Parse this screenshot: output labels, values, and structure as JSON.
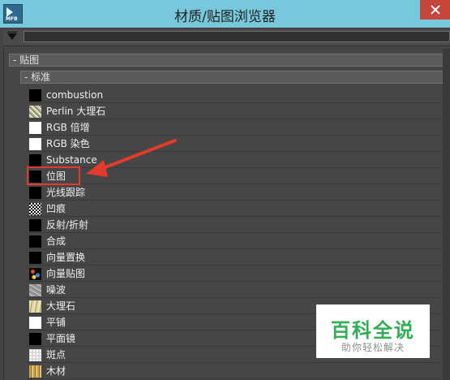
{
  "window": {
    "title": "材质/贴图浏览器"
  },
  "app_icon_text": "MFB",
  "search": {
    "value": "",
    "placeholder": ""
  },
  "groups": {
    "maps": "- 贴图",
    "standard": "- 标准"
  },
  "items": [
    {
      "label": "combustion",
      "icon": "black-swatch-icon"
    },
    {
      "label": "Perlin 大理石",
      "icon": "perlin-marble-icon"
    },
    {
      "label": "RGB 倍增",
      "icon": "white-swatch-icon"
    },
    {
      "label": "RGB 染色",
      "icon": "white-swatch-icon"
    },
    {
      "label": "Substance",
      "icon": "black-swatch-icon"
    },
    {
      "label": "位图",
      "icon": "black-swatch-icon"
    },
    {
      "label": "光线跟踪",
      "icon": "black-swatch-icon"
    },
    {
      "label": "凹痕",
      "icon": "checker-icon"
    },
    {
      "label": "反射/折射",
      "icon": "black-swatch-icon"
    },
    {
      "label": "合成",
      "icon": "black-swatch-icon"
    },
    {
      "label": "向量置换",
      "icon": "black-swatch-icon"
    },
    {
      "label": "向量贴图",
      "icon": "vector-map-icon"
    },
    {
      "label": "噪波",
      "icon": "noise-icon"
    },
    {
      "label": "大理石",
      "icon": "marble-icon"
    },
    {
      "label": "平铺",
      "icon": "tile-icon"
    },
    {
      "label": "平面镜",
      "icon": "black-swatch-icon"
    },
    {
      "label": "斑点",
      "icon": "speckle-icon"
    },
    {
      "label": "木材",
      "icon": "wood-icon"
    }
  ],
  "highlighted_item": "位图",
  "watermark": {
    "title": "百科全说",
    "subtitle": "助你轻松解决"
  },
  "colors": {
    "titlebar": "#78c8dc",
    "close": "#c7463c",
    "annotation": "#e23a2c",
    "watermark_green": "#2fae55"
  }
}
